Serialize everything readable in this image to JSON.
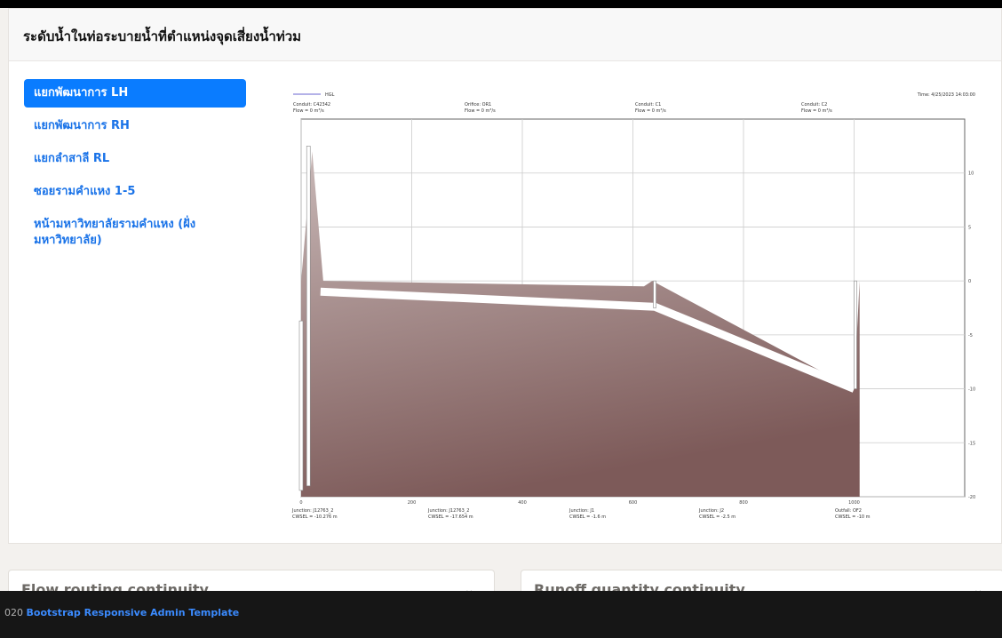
{
  "page": {
    "title": "ระดับน้ำในท่อระบายน้ำที่ตำแหน่งจุดเสี่ยงน้ำท่วม",
    "nav": [
      {
        "label": "แยกพัฒนาการ LH",
        "active": true
      },
      {
        "label": "แยกพัฒนาการ RH",
        "active": false
      },
      {
        "label": "แยกลำสาลี RL",
        "active": false
      },
      {
        "label": "ซอยรามคำแหง 1-5",
        "active": false
      },
      {
        "label": "หน้ามหาวิทยาลัยรามคำแหง (ฝั่ง มหาวิทยาลัย)",
        "active": false
      }
    ]
  },
  "chart_data": {
    "type": "area",
    "legend": "HGL",
    "time_label": "Time: 4/25/2023 14:03:00",
    "conduits": [
      {
        "name": "Conduit: C42342",
        "flow": "Flow = 0 m³/s"
      },
      {
        "name": "Orifice: OR1",
        "flow": "Flow = 0 m³/s"
      },
      {
        "name": "Conduit: C1",
        "flow": "Flow = 0 m³/s"
      },
      {
        "name": "Conduit: C2",
        "flow": "Flow = 0 m³/s"
      }
    ],
    "junctions": [
      {
        "name": "Junction: J12763_2",
        "cwsel": "CWSEL = -10.276 m"
      },
      {
        "name": "Junction: J12763_2",
        "cwsel": "CWSEL = -17.654 m"
      },
      {
        "name": "Junction: J1",
        "cwsel": "CWSEL = -1.6 m"
      },
      {
        "name": "Junction: J2",
        "cwsel": "CWSEL = -2.5 m"
      },
      {
        "name": "Outfall: OF2",
        "cwsel": "CWSEL = -10 m"
      }
    ],
    "x_ticks": [
      "0",
      "200",
      "400",
      "600",
      "800",
      "1000"
    ],
    "y_ticks": [
      "10",
      "5",
      "0",
      "-5",
      "-10",
      "-15",
      "-20"
    ],
    "xlim": [
      0,
      1200
    ],
    "ylim": [
      -20,
      15
    ],
    "ground_profile": {
      "x": [
        0,
        20,
        40,
        620,
        635,
        1000,
        1010
      ],
      "y": [
        0,
        12,
        0,
        -0.5,
        0,
        -10,
        0
      ]
    },
    "hgl_profile": {
      "x": [
        35,
        640,
        1000
      ],
      "y": [
        -1,
        -2.4,
        -10
      ]
    },
    "colors": {
      "fill_top": "#c8b8b7",
      "fill_bottom": "#7d5a59",
      "axis": "#666666",
      "grid": "#cccccc",
      "pipe": "#ffffff"
    }
  },
  "bottom": {
    "left_title": "Flow routing continuity",
    "right_title": "Runoff quantity continuity"
  },
  "footer": {
    "prefix": "020",
    "link": "Bootstrap Responsive Admin Template"
  }
}
